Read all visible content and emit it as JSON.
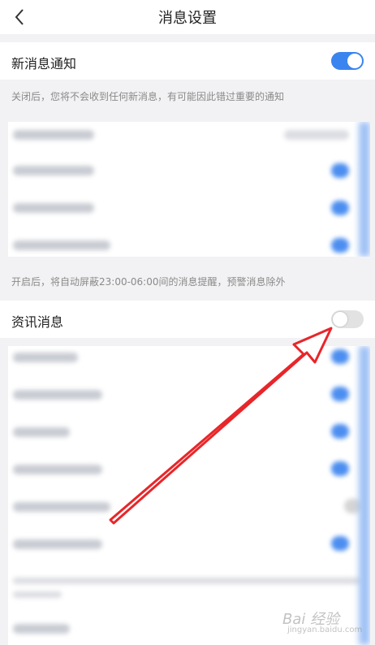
{
  "header": {
    "title": "消息设置"
  },
  "new_message": {
    "label": "新消息通知",
    "enabled": true,
    "hint": "关闭后，您将不会收到任何新消息，有可能因此错过重要的通知"
  },
  "dnd_hint": "开启后，将自动屏蔽23:00-06:00间的消息提醒，预警消息除外",
  "news": {
    "label": "资讯消息",
    "enabled": false
  },
  "colors": {
    "accent": "#3a84f0",
    "annotation_arrow": "#e8262a"
  },
  "watermark": {
    "logo": "Bai 经验",
    "url": "jingyan.baidu.com"
  }
}
